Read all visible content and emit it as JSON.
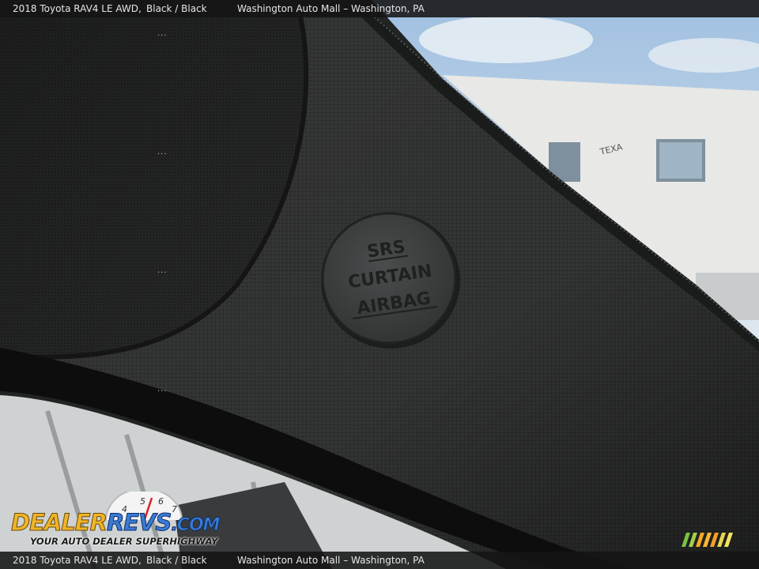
{
  "caption": {
    "vehicle": "2018 Toyota RAV4 LE AWD,",
    "color": "Black / Black",
    "dealer": "Washington Auto Mall – Washington, PA"
  },
  "caption_bottom": {
    "vehicle": "2018 Toyota RAV4 LE AWD,",
    "color": "Black / Black",
    "dealer": "Washington Auto Mall – Washington, PA"
  },
  "emblem": {
    "line1": "SRS",
    "line2": "CURTAIN",
    "line3": "AIRBAG"
  },
  "building_sign": "TEXA",
  "logo": {
    "dealer": "DEALER",
    "revs": "REVS",
    "com": ".COM",
    "tagline": "YOUR AUTO DEALER SUPERHIGHWAY",
    "gauge_numbers": [
      "4",
      "5",
      "6",
      "7"
    ]
  },
  "colors": {
    "trim": "#2a2a2a",
    "sky": "#a9c6e4",
    "building": "#e8e8e6",
    "logo_gold": "#f0b429",
    "logo_blue": "#3a7bd5"
  }
}
